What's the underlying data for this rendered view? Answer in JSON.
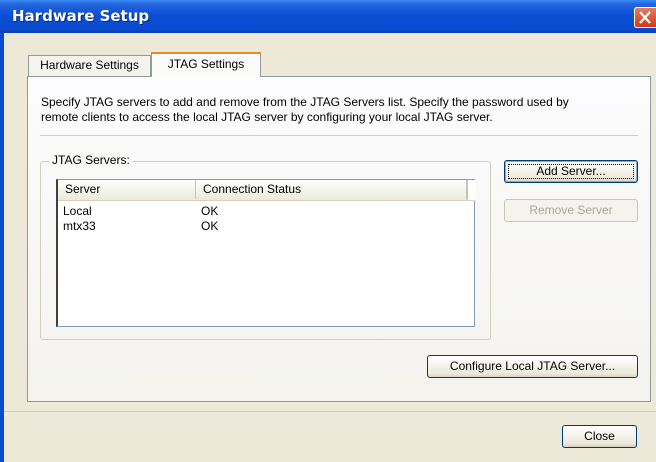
{
  "window": {
    "title": "Hardware Setup",
    "close_icon": "close-icon"
  },
  "tabs": [
    {
      "label": "Hardware Settings",
      "selected": false
    },
    {
      "label": "JTAG Settings",
      "selected": true
    }
  ],
  "jtag": {
    "description_line1": "Specify JTAG servers to add and remove from the JTAG Servers list. Specify the password used by",
    "description_line2": "remote clients to access the local JTAG server by configuring your local JTAG server.",
    "group_label": "JTAG Servers:",
    "columns": [
      "Server",
      "Connection Status"
    ],
    "rows": [
      {
        "server": "Local",
        "status": "OK"
      },
      {
        "server": "mtx33",
        "status": "OK"
      }
    ],
    "add_label": "Add Server...",
    "remove_label": "Remove Server",
    "configure_label": "Configure Local JTAG Server..."
  },
  "footer": {
    "close_label": "Close"
  },
  "colors": {
    "titlebar": "#0a4bd0",
    "close_button": "#d1391e",
    "dialog_bg": "#ece9d8",
    "tab_highlight": "#e68b2c"
  }
}
